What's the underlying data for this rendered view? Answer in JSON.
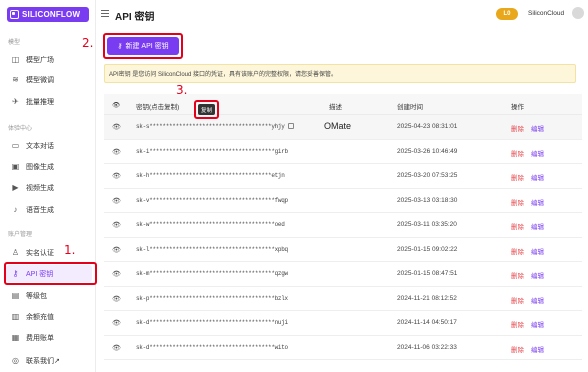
{
  "brand": {
    "name": "SILICONFLOW"
  },
  "header": {
    "title": "API 密钥",
    "level_badge": "L0",
    "user_name": "SiliconCloud"
  },
  "sidebar": {
    "sections": [
      {
        "label": "模型"
      },
      {
        "label": "体验中心"
      },
      {
        "label": "账户管理"
      }
    ],
    "items": [
      {
        "label": "模型广场",
        "icon": "cube-icon"
      },
      {
        "label": "模型微调",
        "icon": "layers-icon"
      },
      {
        "label": "批量推理",
        "icon": "rocket-icon"
      },
      {
        "label": "文本对话",
        "icon": "chat-icon"
      },
      {
        "label": "图像生成",
        "icon": "image-icon"
      },
      {
        "label": "视频生成",
        "icon": "video-icon"
      },
      {
        "label": "语音生成",
        "icon": "mic-icon"
      },
      {
        "label": "实名认证",
        "icon": "id-icon"
      },
      {
        "label": "API 密钥",
        "icon": "key-icon"
      },
      {
        "label": "等级包",
        "icon": "package-icon"
      },
      {
        "label": "余额充值",
        "icon": "wallet-icon"
      },
      {
        "label": "费用账单",
        "icon": "bill-icon"
      },
      {
        "label": "联系我们↗",
        "icon": "help-icon"
      }
    ]
  },
  "main": {
    "new_key_button": "新建 API 密钥",
    "notice": "API密钥 是您访问 SiliconCloud 接口的凭证，具有该账户的完整权限，请您妥善保管。",
    "tooltip": "复制"
  },
  "annotations": {
    "step1": "1.",
    "step2": "2.",
    "step3": "3."
  },
  "table": {
    "columns": [
      "密钥(点击复制)",
      "描述",
      "创建时间",
      "操作"
    ],
    "delete_label": "删除",
    "edit_label": "编辑",
    "rows": [
      {
        "key": "sk-s*************************************yhjy",
        "description": "OMate",
        "created": "2025-04-23 08:31:01"
      },
      {
        "key": "sk-i**************************************girb",
        "description": "",
        "created": "2025-03-26 10:46:49"
      },
      {
        "key": "sk-h*************************************etjn",
        "description": "",
        "created": "2025-03-20 07:53:25"
      },
      {
        "key": "sk-v**************************************fwqp",
        "description": "",
        "created": "2025-03-13 03:18:30"
      },
      {
        "key": "sk-w**************************************oed",
        "description": "",
        "created": "2025-03-11 03:35:20"
      },
      {
        "key": "sk-l**************************************xpbq",
        "description": "",
        "created": "2025-01-15 09:02:22"
      },
      {
        "key": "sk-m**************************************qzgw",
        "description": "",
        "created": "2025-01-15 08:47:51"
      },
      {
        "key": "sk-p**************************************bzlx",
        "description": "",
        "created": "2024-11-21 08:12:52"
      },
      {
        "key": "sk-d**************************************nuji",
        "description": "",
        "created": "2024-11-14 04:50:17"
      },
      {
        "key": "sk-d**************************************wito",
        "description": "",
        "created": "2024-11-06 03:22:33"
      }
    ]
  },
  "colors": {
    "accent": "#7a3cf0",
    "annotation": "#e4001b",
    "danger": "#e5484d",
    "badge": "#e9a81c"
  }
}
